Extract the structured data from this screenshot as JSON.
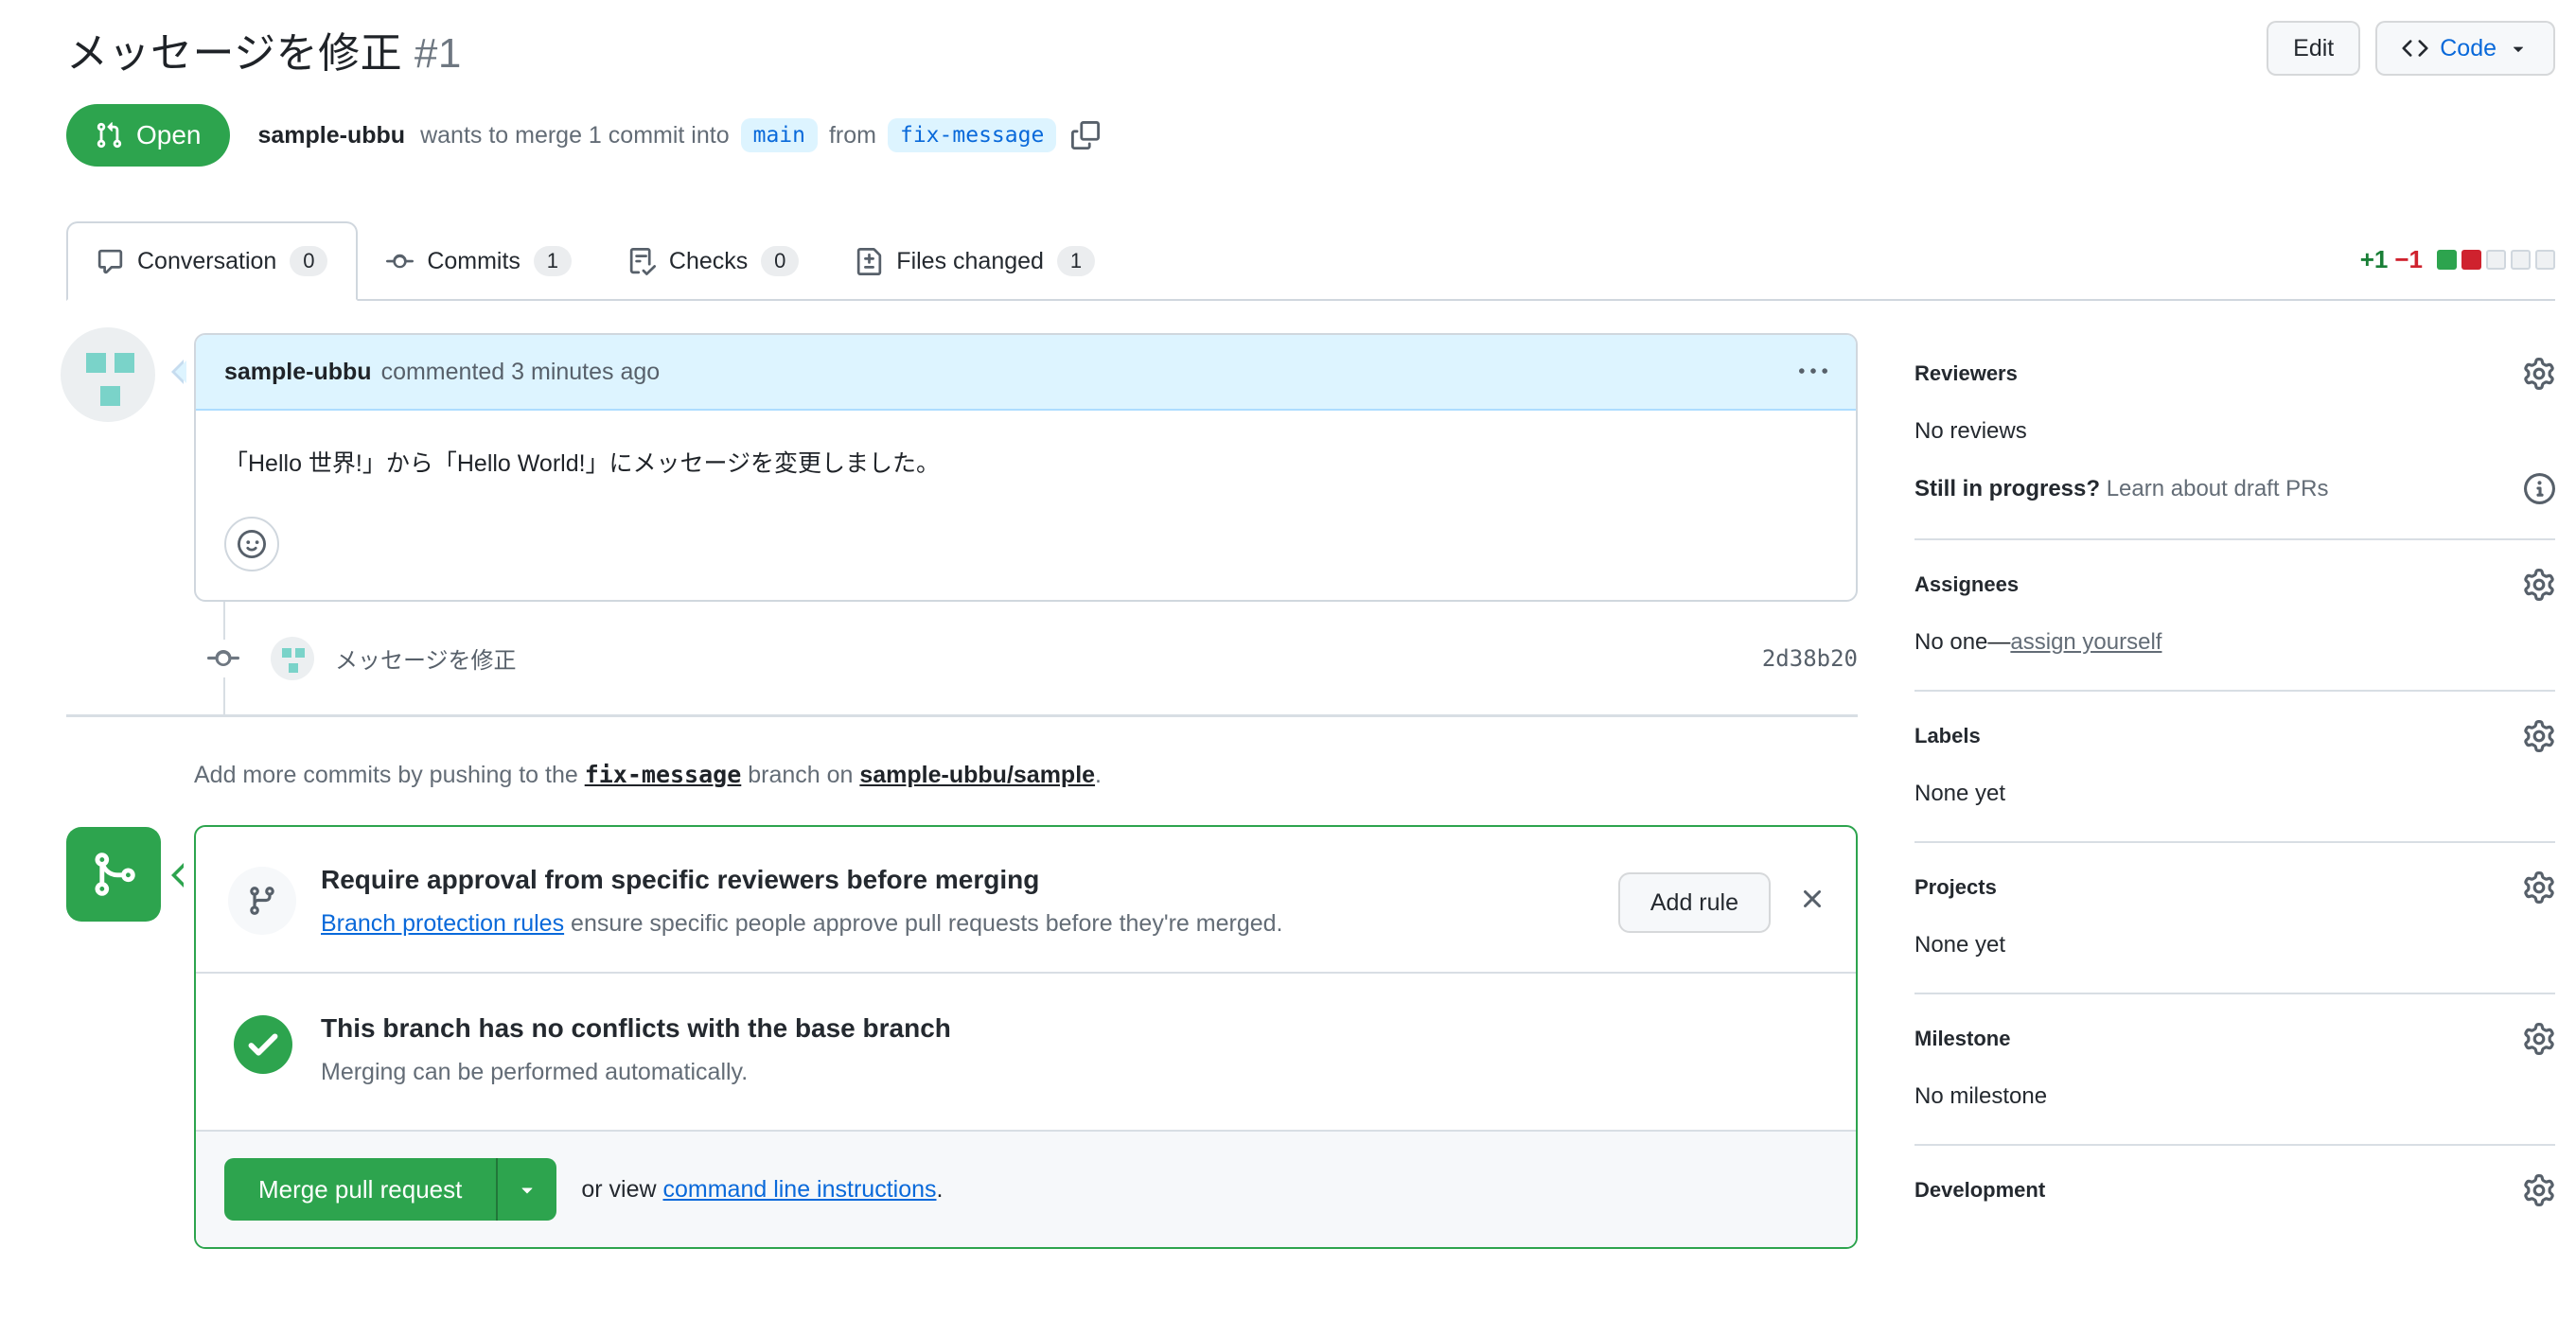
{
  "header": {
    "title": "メッセージを修正",
    "number": "#1",
    "edit_button": "Edit",
    "code_button": "Code",
    "status_badge": "Open",
    "author": "sample-ubbu",
    "merge_text_1": "wants to merge 1 commit into",
    "base_branch": "main",
    "merge_text_2": "from",
    "head_branch": "fix-message"
  },
  "tabs": [
    {
      "label": "Conversation",
      "count": "0",
      "active": true
    },
    {
      "label": "Commits",
      "count": "1",
      "active": false
    },
    {
      "label": "Checks",
      "count": "0",
      "active": false
    },
    {
      "label": "Files changed",
      "count": "1",
      "active": false
    }
  ],
  "diffstat": {
    "additions": "+1",
    "deletions": "−1",
    "blocks": [
      "green",
      "red",
      "empty",
      "empty",
      "empty"
    ]
  },
  "comment": {
    "author": "sample-ubbu",
    "meta": "commented 3 minutes ago",
    "body": "「Hello 世界!」から「Hello World!」にメッセージを変更しました。"
  },
  "commit": {
    "message": "メッセージを修正",
    "sha": "2d38b20"
  },
  "push_hint": {
    "text_1": "Add more commits by pushing to the ",
    "branch": "fix-message",
    "text_2": " branch on ",
    "repo": "sample-ubbu/sample",
    "text_3": "."
  },
  "merge_box": {
    "protection": {
      "title": "Require approval from specific reviewers before merging",
      "link": "Branch protection rules",
      "rest": " ensure specific people approve pull requests before they're merged.",
      "add_rule_button": "Add rule"
    },
    "conflicts": {
      "title": "This branch has no conflicts with the base branch",
      "sub": "Merging can be performed automatically."
    },
    "cta": {
      "merge_button": "Merge pull request",
      "or_view": "or view ",
      "link": "command line instructions",
      "period": "."
    }
  },
  "sidebar": {
    "reviewers": {
      "title": "Reviewers",
      "empty": "No reviews",
      "draft_bold": "Still in progress?",
      "draft_link": "Learn about draft PRs"
    },
    "assignees": {
      "title": "Assignees",
      "empty": "No one—",
      "link": "assign yourself"
    },
    "labels": {
      "title": "Labels",
      "empty": "None yet"
    },
    "projects": {
      "title": "Projects",
      "empty": "None yet"
    },
    "milestone": {
      "title": "Milestone",
      "empty": "No milestone"
    },
    "development": {
      "title": "Development"
    }
  },
  "icons": {
    "pull-request-icon": "git pull request glyph",
    "code-icon": "<>",
    "copy-icon": "overlapping squares",
    "comment-icon": "speech bubble",
    "commit-icon": "circle with side ticks",
    "checklist-icon": "list with check",
    "file-diff-icon": "file with plus",
    "kebab-icon": "…",
    "smiley-icon": "☺",
    "git-branch-icon": "branch glyph",
    "git-merge-icon": "merge glyph",
    "check-circle-icon": "✓ in filled circle",
    "gear-icon": "⚙",
    "info-icon": "ⓘ",
    "caret-down-icon": "▾",
    "close-icon": "✕"
  },
  "colors": {
    "open_badge_green": "#2da44e",
    "merge_button_green": "#2da44e",
    "link_blue": "#0969da",
    "branch_label_bg": "#ddf4ff",
    "comment_header_bg": "#ddf4ff",
    "addition_green": "#1a7f37",
    "deletion_red": "#cf222e",
    "muted_text": "#636c76",
    "border": "#d0d7de"
  }
}
